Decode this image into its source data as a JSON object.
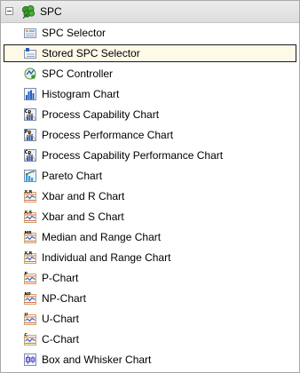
{
  "root": {
    "label": "SPC",
    "icon": "clover-icon",
    "expanded": true
  },
  "items": [
    {
      "label": "SPC Selector",
      "icon": "selector-icon"
    },
    {
      "label": "Stored SPC Selector",
      "icon": "stored-selector-icon",
      "selected": true
    },
    {
      "label": "SPC Controller",
      "icon": "controller-icon"
    },
    {
      "label": "Histogram Chart",
      "icon": "histogram-icon"
    },
    {
      "label": "Process Capability Chart",
      "icon": "capability-chart-icon",
      "badge": "Cp"
    },
    {
      "label": "Process Performance Chart",
      "icon": "performance-chart-icon",
      "badge": "Pp"
    },
    {
      "label": "Process Capability Performance Chart",
      "icon": "capability-performance-chart-icon",
      "badge": "Cp"
    },
    {
      "label": "Pareto Chart",
      "icon": "pareto-icon"
    },
    {
      "label": "Xbar and R Chart",
      "icon": "xbar-r-chart-icon",
      "badge": "X,R"
    },
    {
      "label": "Xbar and S Chart",
      "icon": "xbar-s-chart-icon",
      "badge": "X,S"
    },
    {
      "label": "Median and Range Chart",
      "icon": "median-range-chart-icon",
      "badge": "MR"
    },
    {
      "label": "Individual and Range Chart",
      "icon": "individual-range-chart-icon",
      "badge": "X,R"
    },
    {
      "label": "P-Chart",
      "icon": "p-chart-icon",
      "badge": "P"
    },
    {
      "label": "NP-Chart",
      "icon": "np-chart-icon",
      "badge": "NP"
    },
    {
      "label": "U-Chart",
      "icon": "u-chart-icon",
      "badge": "U"
    },
    {
      "label": "C-Chart",
      "icon": "c-chart-icon",
      "badge": "C"
    },
    {
      "label": "Box and Whisker Chart",
      "icon": "box-whisker-chart-icon"
    }
  ],
  "colors": {
    "selected_bg": "#fff9e8",
    "selected_border": "#1a1a1a",
    "icon_blue": "#2a5fbf",
    "icon_orange": "#e9a23b",
    "clover_green": "#3b9a2f"
  }
}
